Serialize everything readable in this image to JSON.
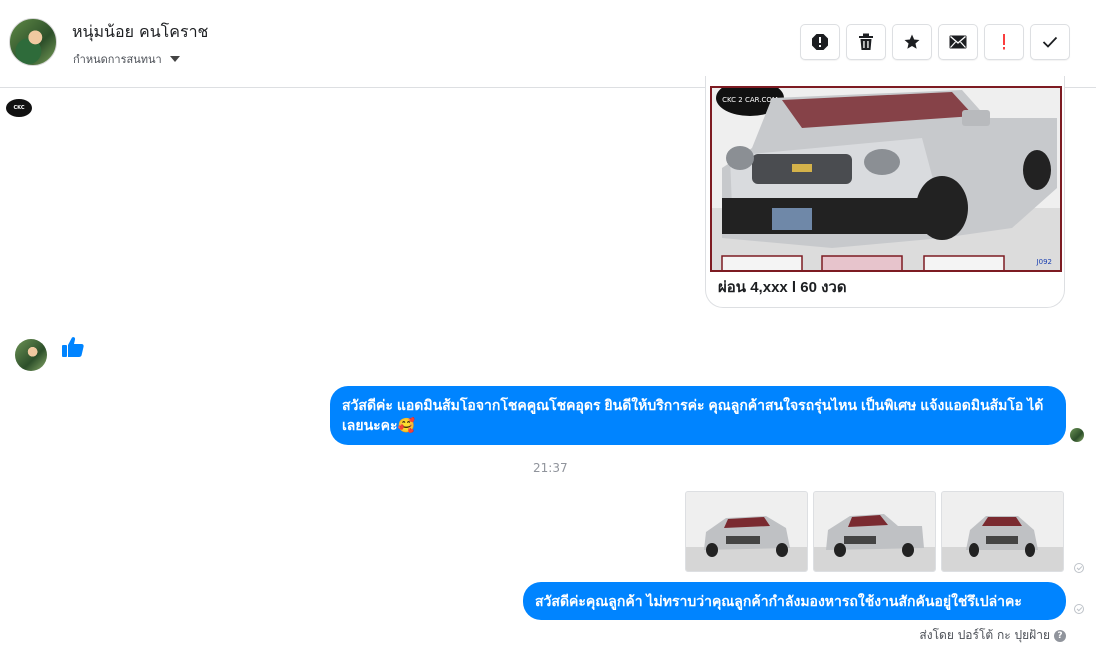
{
  "header": {
    "contact_name": "หนุ่มน้อย คนโคราช",
    "conversation_settings": "กำหนดการสนทนา",
    "toolbar": [
      {
        "name": "report-spam-icon",
        "color": "#1c1e21"
      },
      {
        "name": "trash-icon",
        "color": "#1c1e21"
      },
      {
        "name": "star-icon",
        "color": "#1c1e21"
      },
      {
        "name": "envelope-icon",
        "color": "#1c1e21"
      },
      {
        "name": "important-icon",
        "color": "#fa3e3e"
      },
      {
        "name": "checkmark-icon",
        "color": "#1c1e21"
      }
    ]
  },
  "messages": {
    "card": {
      "logo_text": "CKC 2 CAR.COM",
      "plate_code": "J092",
      "caption": "ผ่อน 4,xxx l 60 งวด"
    },
    "received_like": "thumbs-up-icon",
    "sent_1": "สวัสดีค่ะ แอดมินส้มโอจากโชคคูณโชคอุดร ยินดีให้บริการค่ะ   คุณลูกค้าสนใจรถรุ่นไหน เป็นพิเศษ แจ้งแอดมินส้มโอ ได้เลยนะคะ🥰",
    "timestamp": "21:37",
    "photos": [
      "car-front-photo-1",
      "car-side-photo-2",
      "car-front-photo-3"
    ],
    "sent_2": "สวัสดีค่ะคุณลูกค้า ไม่ทราบว่าคุณลูกค้ากำลังมองหารถใช้งานสักคันอยู่ใช่รึเปล่าคะ",
    "sent_by": "ส่งโดย ปอร์โต้ กะ ปุยฝ้าย",
    "accent_color": "#0084ff"
  }
}
